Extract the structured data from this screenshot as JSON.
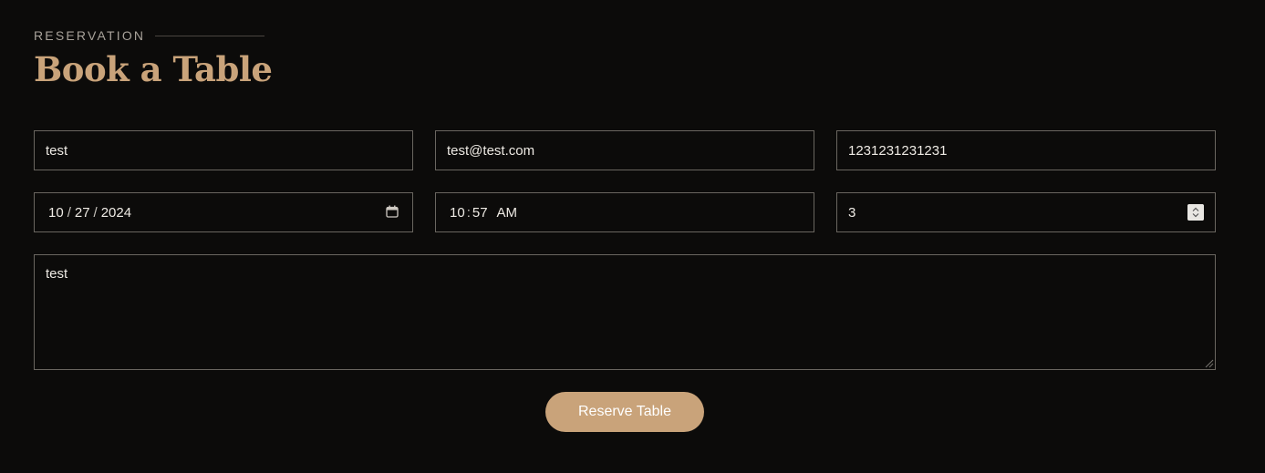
{
  "section": {
    "eyebrow": "RESERVATION",
    "title": "Book a Table"
  },
  "form": {
    "name_value": "test",
    "email_value": "test@test.com",
    "phone_value": "1231231231231",
    "date": {
      "month": "10",
      "day": "27",
      "year": "2024",
      "separator": "/"
    },
    "time": {
      "hour": "10",
      "minute": "57",
      "period": "AM",
      "separator": ":"
    },
    "people_value": "3",
    "message_value": "test",
    "submit_label": "Reserve Table"
  },
  "icons": {
    "date_picker": "calendar-icon",
    "number_spinner": "spinner-arrows-icon",
    "textarea_resize": "resize-grip-icon"
  },
  "colors": {
    "background": "#0c0b0a",
    "accent": "#c9a37a",
    "field_border": "#6a6660",
    "eyebrow_text": "#a8a29a",
    "field_text": "#eeeae4"
  }
}
